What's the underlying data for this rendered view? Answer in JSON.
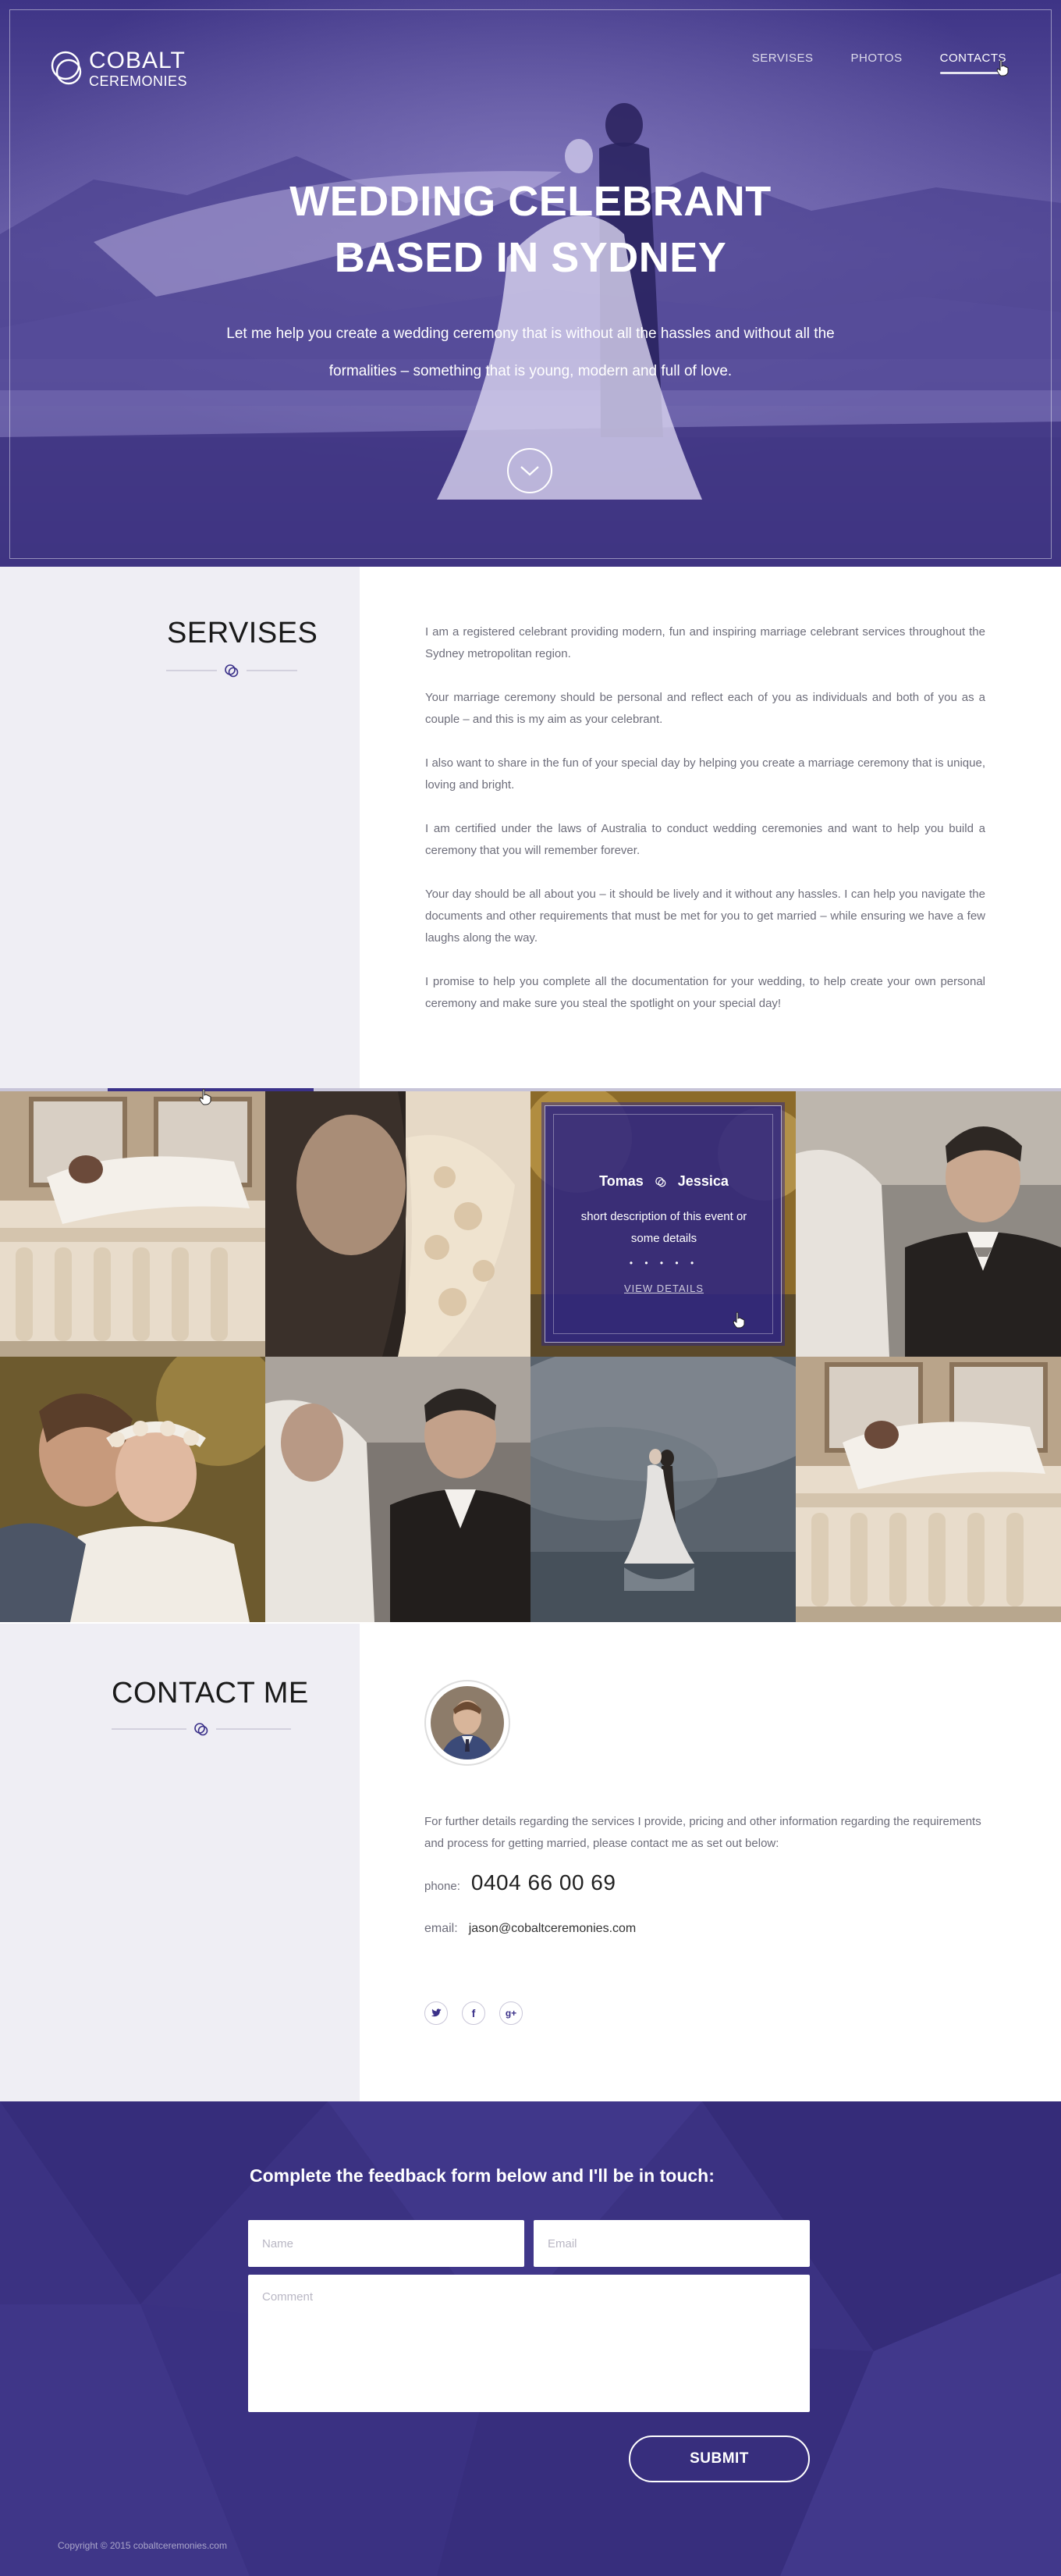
{
  "brand": {
    "name_top": "COBALT",
    "name_bottom": "CEREMONIES"
  },
  "nav": {
    "items": [
      {
        "label": "SERVISES"
      },
      {
        "label": "PHOTOS"
      },
      {
        "label": "CONTACTS",
        "active": true
      }
    ]
  },
  "hero": {
    "title_line1": "WEDDING CELEBRANT",
    "title_line2": "BASED IN SYDNEY",
    "subtitle": "Let me help you create a wedding ceremony that is without all the hassles and without all the formalities – something that is young, modern and full of love."
  },
  "services": {
    "title": "SERVISES",
    "paragraphs": [
      "I am a registered celebrant providing modern, fun and inspiring marriage celebrant services throughout the Sydney metropolitan region.",
      "Your marriage ceremony should be personal and reflect each of you as individuals and both of you as a couple – and this is my aim as your celebrant.",
      "I also want to share in the fun of your special day by helping you create a marriage ceremony that is unique, loving and bright.",
      "I am certified under the laws of Australia to conduct wedding ceremonies and want to help you build a ceremony that you will remember forever.",
      "Your day should be all about you – it should be lively and it without any hassles. I can help you navigate the documents and other requirements that must be met for you to get married – while ensuring we have a few laughs along the way.",
      "I promise to help you complete all the documentation for your wedding, to help create your own personal ceremony and make sure you steal the spotlight on your special day!"
    ]
  },
  "gallery": {
    "overlay": {
      "name1": "Tomas",
      "name2": "Jessica",
      "description": "short description of this event or some details",
      "dots": "• • • • •",
      "link": "VIEW DETAILS"
    }
  },
  "contact": {
    "title": "CONTACT ME",
    "text": "For further details regarding the services I provide, pricing and other information regarding the requirements and process for getting married, please contact me as set out below:",
    "phone_label": "phone:",
    "phone": "0404 66 00 69",
    "email_label": "email:",
    "email": "jason@cobaltceremonies.com",
    "socials": [
      {
        "icon": "twitter-icon",
        "glyph": "🐦"
      },
      {
        "icon": "facebook-icon",
        "glyph": "f"
      },
      {
        "icon": "google-plus-icon",
        "glyph": "g+"
      }
    ]
  },
  "feedback": {
    "title": "Complete the feedback form below and I'll be in touch:",
    "name_placeholder": "Name",
    "email_placeholder": "Email",
    "comment_placeholder": "Comment",
    "submit_label": "SUBMIT"
  },
  "footer": {
    "copyright": "Copyright © 2015 cobaltceremonies.com"
  },
  "colors": {
    "accent": "#3b3189",
    "hero_tint": "#5a4f9e",
    "side_panel": "#efeef4",
    "feedback_bg": "#3b3282"
  }
}
